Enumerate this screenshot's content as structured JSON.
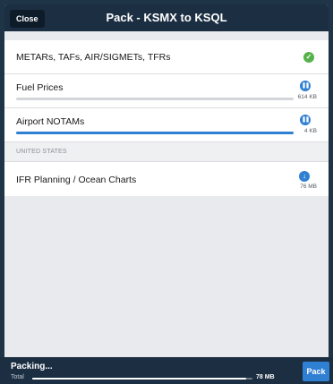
{
  "header": {
    "close_label": "Close",
    "title": "Pack - KSMX to KSQL"
  },
  "list": {
    "weather": {
      "label": "METARs, TAFs, AIR/SIGMETs, TFRs",
      "status": "complete",
      "icon": "check-icon"
    },
    "fuel": {
      "label": "Fuel Prices",
      "size": "614 KB",
      "progress": 0.0,
      "icon": "pause-icon"
    },
    "notams": {
      "label": "Airport NOTAMs",
      "size": "4 KB",
      "progress": 1.0,
      "icon": "pause-icon"
    },
    "section_header": "UNITED STATES",
    "charts": {
      "label": "IFR Planning / Ocean Charts",
      "size": "76 MB",
      "icon": "download-icon"
    }
  },
  "footer": {
    "status": "Packing...",
    "total_label": "Total",
    "total_size": "78 MB",
    "total_progress": 0.97,
    "pack_label": "Pack"
  },
  "colors": {
    "accent": "#2f7fd3",
    "success": "#56b24b",
    "navy": "#1c2f42"
  }
}
